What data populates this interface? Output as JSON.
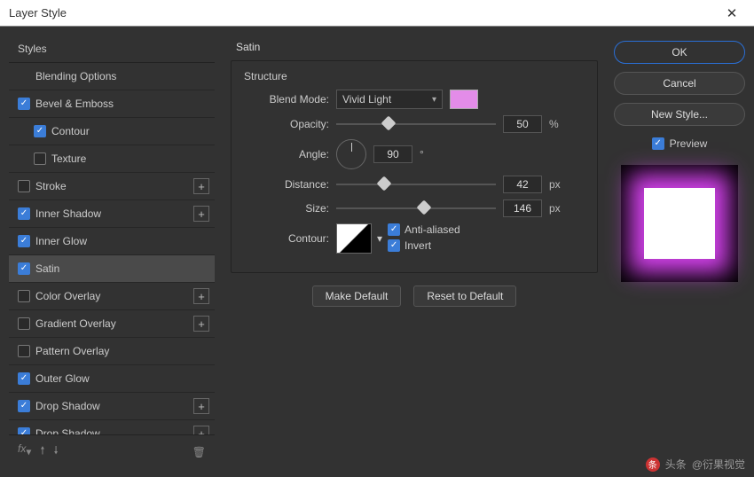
{
  "window": {
    "title": "Layer Style"
  },
  "sidebar": {
    "header": "Styles",
    "items": [
      {
        "label": "Blending Options",
        "checked": null,
        "plus": false,
        "indent": false
      },
      {
        "label": "Bevel & Emboss",
        "checked": true,
        "plus": false,
        "indent": false
      },
      {
        "label": "Contour",
        "checked": true,
        "plus": false,
        "indent": true
      },
      {
        "label": "Texture",
        "checked": false,
        "plus": false,
        "indent": true
      },
      {
        "label": "Stroke",
        "checked": false,
        "plus": true,
        "indent": false
      },
      {
        "label": "Inner Shadow",
        "checked": true,
        "plus": true,
        "indent": false
      },
      {
        "label": "Inner Glow",
        "checked": true,
        "plus": false,
        "indent": false
      },
      {
        "label": "Satin",
        "checked": true,
        "plus": false,
        "indent": false,
        "selected": true
      },
      {
        "label": "Color Overlay",
        "checked": false,
        "plus": true,
        "indent": false
      },
      {
        "label": "Gradient Overlay",
        "checked": false,
        "plus": true,
        "indent": false
      },
      {
        "label": "Pattern Overlay",
        "checked": false,
        "plus": false,
        "indent": false
      },
      {
        "label": "Outer Glow",
        "checked": true,
        "plus": false,
        "indent": false
      },
      {
        "label": "Drop Shadow",
        "checked": true,
        "plus": true,
        "indent": false
      },
      {
        "label": "Drop Shadow",
        "checked": true,
        "plus": true,
        "indent": false
      }
    ],
    "fx_label": "fx"
  },
  "panel": {
    "title": "Satin",
    "section": "Structure",
    "blend_mode_label": "Blend Mode:",
    "blend_mode_value": "Vivid Light",
    "swatch_color": "#e38ce8",
    "opacity_label": "Opacity:",
    "opacity_value": "50",
    "opacity_unit": "%",
    "opacity_pct": 33,
    "angle_label": "Angle:",
    "angle_value": "90",
    "angle_unit": "°",
    "distance_label": "Distance:",
    "distance_value": "42",
    "distance_unit": "px",
    "distance_pct": 30,
    "size_label": "Size:",
    "size_value": "146",
    "size_unit": "px",
    "size_pct": 55,
    "contour_label": "Contour:",
    "anti_aliased_label": "Anti-aliased",
    "anti_aliased": true,
    "invert_label": "Invert",
    "invert": true,
    "make_default": "Make Default",
    "reset_default": "Reset to Default"
  },
  "right": {
    "ok": "OK",
    "cancel": "Cancel",
    "new_style": "New Style...",
    "preview_label": "Preview",
    "preview_checked": true
  },
  "watermark": {
    "text1": "头条",
    "at": "@衍果视觉"
  }
}
